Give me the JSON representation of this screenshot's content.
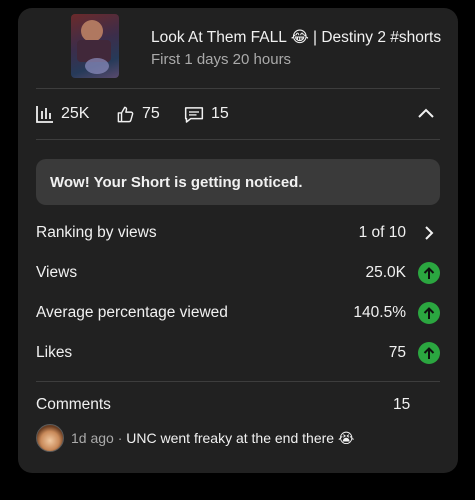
{
  "video": {
    "title": "Look At Them FALL 😂 | Destiny 2 #shorts",
    "subtitle": "First 1 days 20 hours"
  },
  "stats": {
    "views": "25K",
    "likes": "75",
    "comments": "15"
  },
  "banner": {
    "text": "Wow! Your Short is getting noticed."
  },
  "metrics": [
    {
      "label": "Ranking by views",
      "value": "1 of 10",
      "indicator": "chevron-right-icon"
    },
    {
      "label": "Views",
      "value": "25.0K",
      "indicator": "arrow-up-icon"
    },
    {
      "label": "Average percentage viewed",
      "value": "140.5%",
      "indicator": "arrow-up-icon"
    },
    {
      "label": "Likes",
      "value": "75",
      "indicator": "arrow-up-icon"
    }
  ],
  "comments_section": {
    "label": "Comments",
    "count": "15",
    "top_comment": {
      "time": "1d ago",
      "separator": " · ",
      "text": "UNC went freaky at the end there 😭"
    }
  },
  "colors": {
    "card_bg": "#212121",
    "banner_bg": "#3a3a3a",
    "accent_green": "#2ba640",
    "secondary_text": "#aaaaaa"
  }
}
